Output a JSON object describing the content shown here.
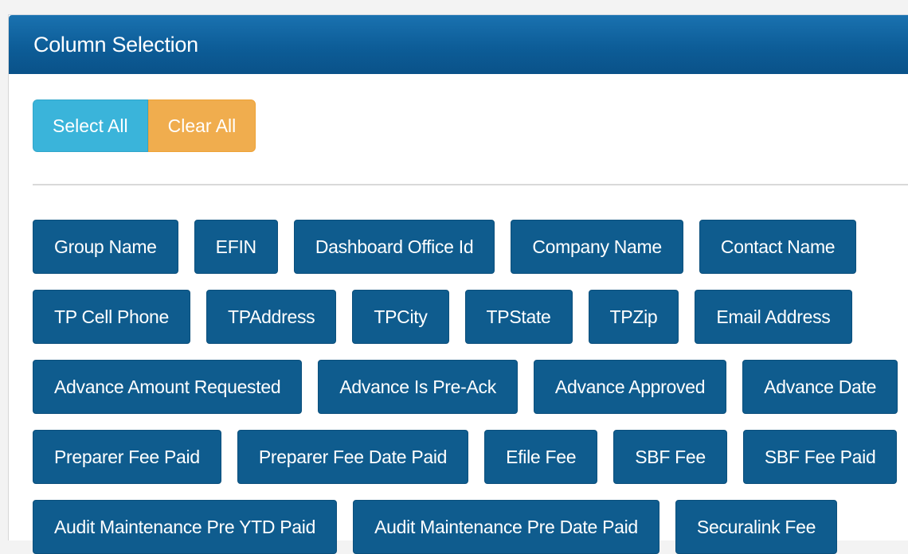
{
  "panel": {
    "title": "Column Selection"
  },
  "actions": {
    "select_all_label": "Select All",
    "clear_all_label": "Clear All"
  },
  "colors": {
    "header_blue": "#0d5d98",
    "column_button": "#0f5c8e",
    "select_all": "#3ab4da",
    "clear_all": "#f0ad4e"
  },
  "columns": {
    "rows": [
      [
        "Group Name",
        "EFIN",
        "Dashboard Office Id",
        "Company Name",
        "Contact Name"
      ],
      [
        "TP Cell Phone",
        "TPAddress",
        "TPCity",
        "TPState",
        "TPZip",
        "Email Address"
      ],
      [
        "Advance Amount Requested",
        "Advance Is Pre-Ack",
        "Advance Approved",
        "Advance Date"
      ],
      [
        "Preparer Fee Paid",
        "Preparer Fee Date Paid",
        "Efile Fee",
        "SBF Fee",
        "SBF Fee Paid"
      ],
      [
        "Audit Maintenance Pre YTD Paid",
        "Audit Maintenance Pre Date Paid",
        "Securalink Fee"
      ]
    ]
  }
}
